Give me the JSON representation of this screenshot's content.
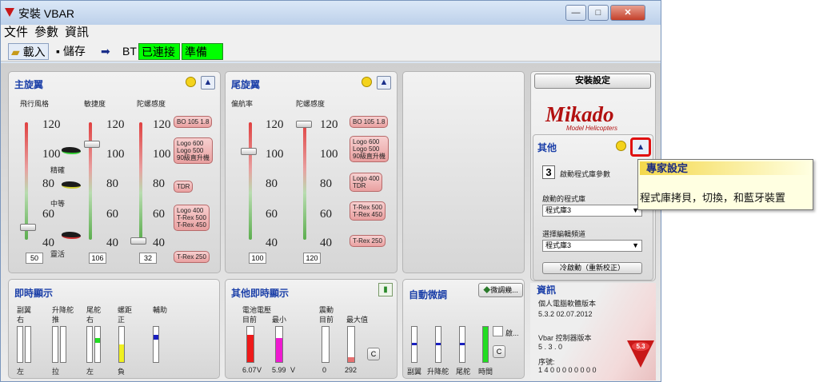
{
  "window": {
    "title": "安裝 VBAR",
    "min": "—",
    "max": "□",
    "close": "✕"
  },
  "menu": [
    "文件",
    "參數",
    "資訊"
  ],
  "toolbar": {
    "load": "載入",
    "save": "儲存",
    "bt": "BT",
    "connected": "已連接",
    "ready": "準備"
  },
  "main_rotor": {
    "title": "主旋翼",
    "col1": "飛行風格",
    "col2": "敏捷度",
    "col3": "陀螺感度",
    "ticks": [
      "120",
      "100",
      "80",
      "60",
      "40"
    ],
    "style_labels": [
      "精確",
      "中等",
      "靈活"
    ],
    "values": [
      "50",
      "106",
      "32"
    ],
    "tags": [
      "BO 105 1.8",
      "Logo 600\nLogo 500\n90級直升機",
      "TDR",
      "Logo 400\nT-Rex 500\nT-Rex 450",
      "T-Rex 250"
    ]
  },
  "tail_rotor": {
    "title": "尾旋翼",
    "col1": "偏航率",
    "col2": "陀螺感度",
    "ticks": [
      "120",
      "100",
      "80",
      "60",
      "40"
    ],
    "values": [
      "100",
      "120"
    ],
    "tags": [
      "BO 105 1.8",
      "Logo 600\nLogo 500\n90級直升機",
      "Logo 400\nTDR",
      "T-Rex 500\nT-Rex 450",
      "T-Rex 250"
    ]
  },
  "setup_button": "安裝設定",
  "logo": {
    "brand": "Mikado",
    "sub": "Model Helicopters"
  },
  "other": {
    "title": "其他",
    "bank_count": "3",
    "bank_count_label": "啟動程式庫參數",
    "active_bank_label": "啟動的程式庫",
    "active_bank": "程式庫3",
    "edit_bank_label": "選擇編輯頻道",
    "edit_bank": "程式庫3",
    "cold_start": "冷啟動（重新校正）"
  },
  "tooltip": {
    "title": "專家設定",
    "body": "程式庫拷貝，切換，和藍牙裝置"
  },
  "realtime": {
    "title": "即時顯示",
    "cols": [
      "副翼",
      "升降舵",
      "尾舵",
      "螺距",
      "輔助"
    ],
    "top": [
      "右",
      "推",
      "右",
      "正",
      ""
    ],
    "bottom": [
      "左",
      "拉",
      "左",
      "負",
      ""
    ]
  },
  "other_realtime": {
    "title": "其他即時顯示",
    "battery": "電池電壓",
    "current": "目前",
    "min": "最小",
    "vib": "震動",
    "vcur": "目前",
    "vmax": "最大值",
    "bat_cur": "6.07",
    "bat_min": "5.99",
    "volt": "V",
    "vib_cur": "0",
    "vib_max": "292",
    "clear": "C"
  },
  "auto_trim": {
    "title": "自動微調",
    "trim_btn": "微調幾...",
    "cols": [
      "副翼",
      "升降舵",
      "尾舵",
      "時間"
    ],
    "enable": "啟...",
    "clear": "C"
  },
  "info": {
    "title": "資訊",
    "pc_label": "個人電腦軟體版本",
    "pc_ver": "5.3.2  02.07.2012",
    "vbar_label": "Vbar 控制器版本",
    "vbar_ver": "5 . 3 . 0",
    "serial_label": "序號:",
    "serial": "1 4 0 0 0 0 0 0 0 0",
    "badge": "5.3"
  },
  "colors": {
    "title_blue": "#1b3fa8",
    "green": "#00ff00",
    "tooltip_bg": "#ffffe1"
  }
}
